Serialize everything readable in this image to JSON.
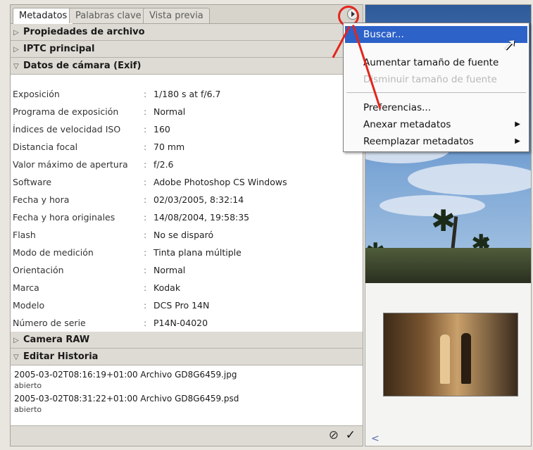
{
  "tabs": [
    "Metadatos",
    "Palabras clave",
    "Vista previa"
  ],
  "sections": {
    "file_props": "Propiedades de archivo",
    "iptc": "IPTC principal",
    "exif": "Datos de cámara (Exif)",
    "camera_raw": "Camera RAW",
    "history": "Editar Historia"
  },
  "exif_rows": [
    {
      "label": "Exposición",
      "value": "1/180 s at f/6.7"
    },
    {
      "label": "Programa de exposición",
      "value": "Normal"
    },
    {
      "label": "Índices de velocidad ISO",
      "value": "160"
    },
    {
      "label": "Distancia focal",
      "value": "70 mm"
    },
    {
      "label": "Valor máximo de apertura",
      "value": "f/2.6"
    },
    {
      "label": "Software",
      "value": "Adobe Photoshop CS Windows"
    },
    {
      "label": "Fecha y hora",
      "value": "02/03/2005, 8:32:14"
    },
    {
      "label": "Fecha y hora originales",
      "value": "14/08/2004, 19:58:35"
    },
    {
      "label": "Flash",
      "value": "No se disparó"
    },
    {
      "label": "Modo de medición",
      "value": "Tinta plana múltiple"
    },
    {
      "label": "Orientación",
      "value": "Normal"
    },
    {
      "label": "Marca",
      "value": "Kodak"
    },
    {
      "label": "Modelo",
      "value": "DCS Pro 14N"
    },
    {
      "label": "Número de serie",
      "value": "P14N-04020"
    }
  ],
  "history": [
    {
      "line": "2005-03-02T08:16:19+01:00 Archivo GD8G6459.jpg",
      "sub": "abierto"
    },
    {
      "line": "2005-03-02T08:31:22+01:00 Archivo GD8G6459.psd",
      "sub": "abierto"
    }
  ],
  "menu": {
    "search": "Buscar...",
    "increase_font": "Aumentar tamaño de fuente",
    "decrease_font": "Disminuir tamaño de fuente",
    "preferences": "Preferencias...",
    "append": "Anexar metadatos",
    "replace": "Reemplazar metadatos"
  },
  "icons": {
    "panel_menu": "panel-menu-icon",
    "submenu": "submenu-arrow-icon",
    "cancel": "cancel-icon",
    "apply": "checkmark-icon",
    "cursor": "mouse-cursor-icon"
  },
  "colors": {
    "menu_selection": "#2d62c9",
    "annotation": "#e3261c",
    "section_bg": "#dedbd4"
  }
}
